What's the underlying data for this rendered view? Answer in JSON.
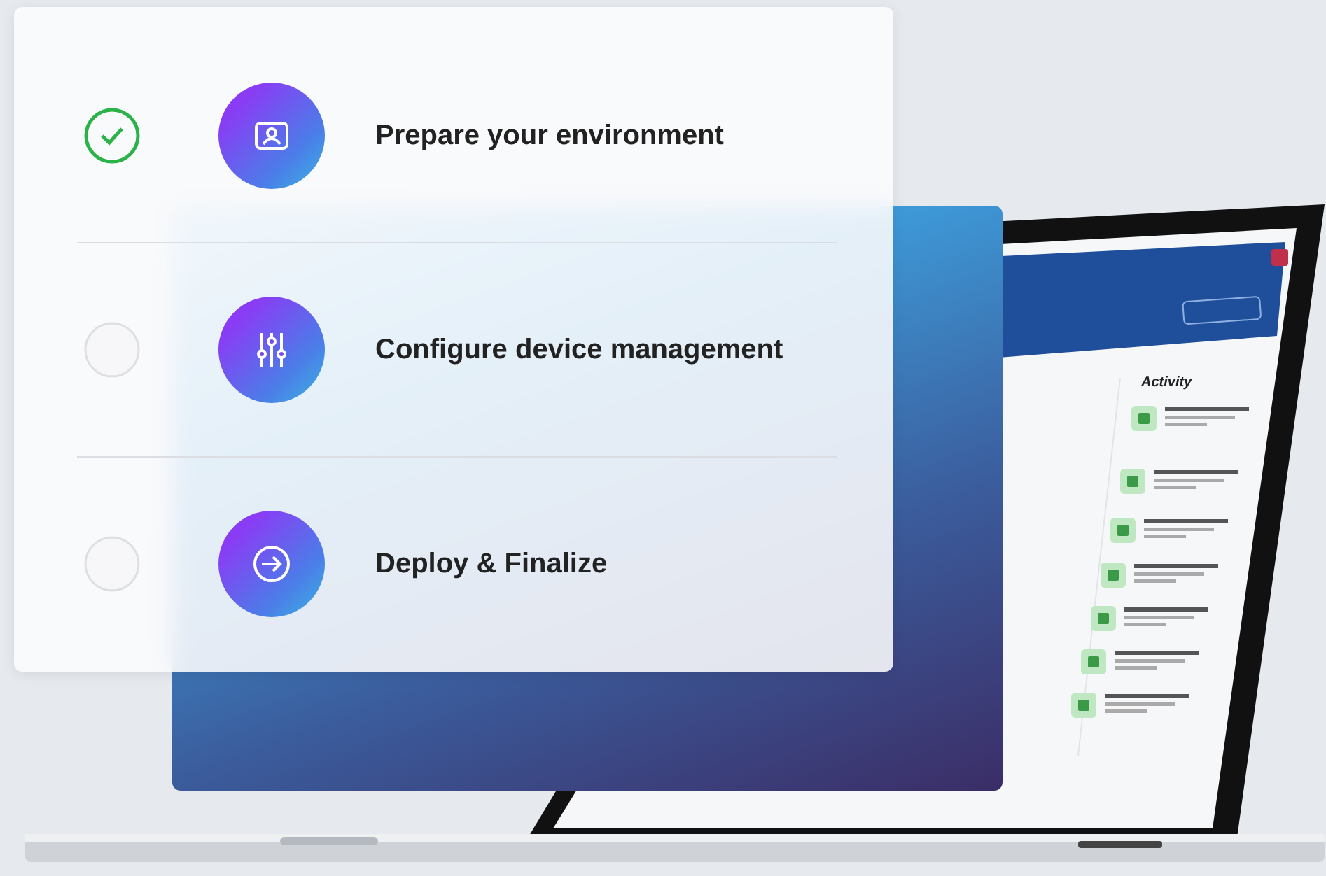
{
  "steps": [
    {
      "label": "Prepare your environment",
      "checked": true,
      "kind": "person"
    },
    {
      "label": "Configure device management",
      "checked": false,
      "kind": "sliders"
    },
    {
      "label": "Deploy & Finalize",
      "checked": false,
      "kind": "arrow"
    }
  ],
  "laptop_screen": {
    "activity_heading": "Activity"
  }
}
